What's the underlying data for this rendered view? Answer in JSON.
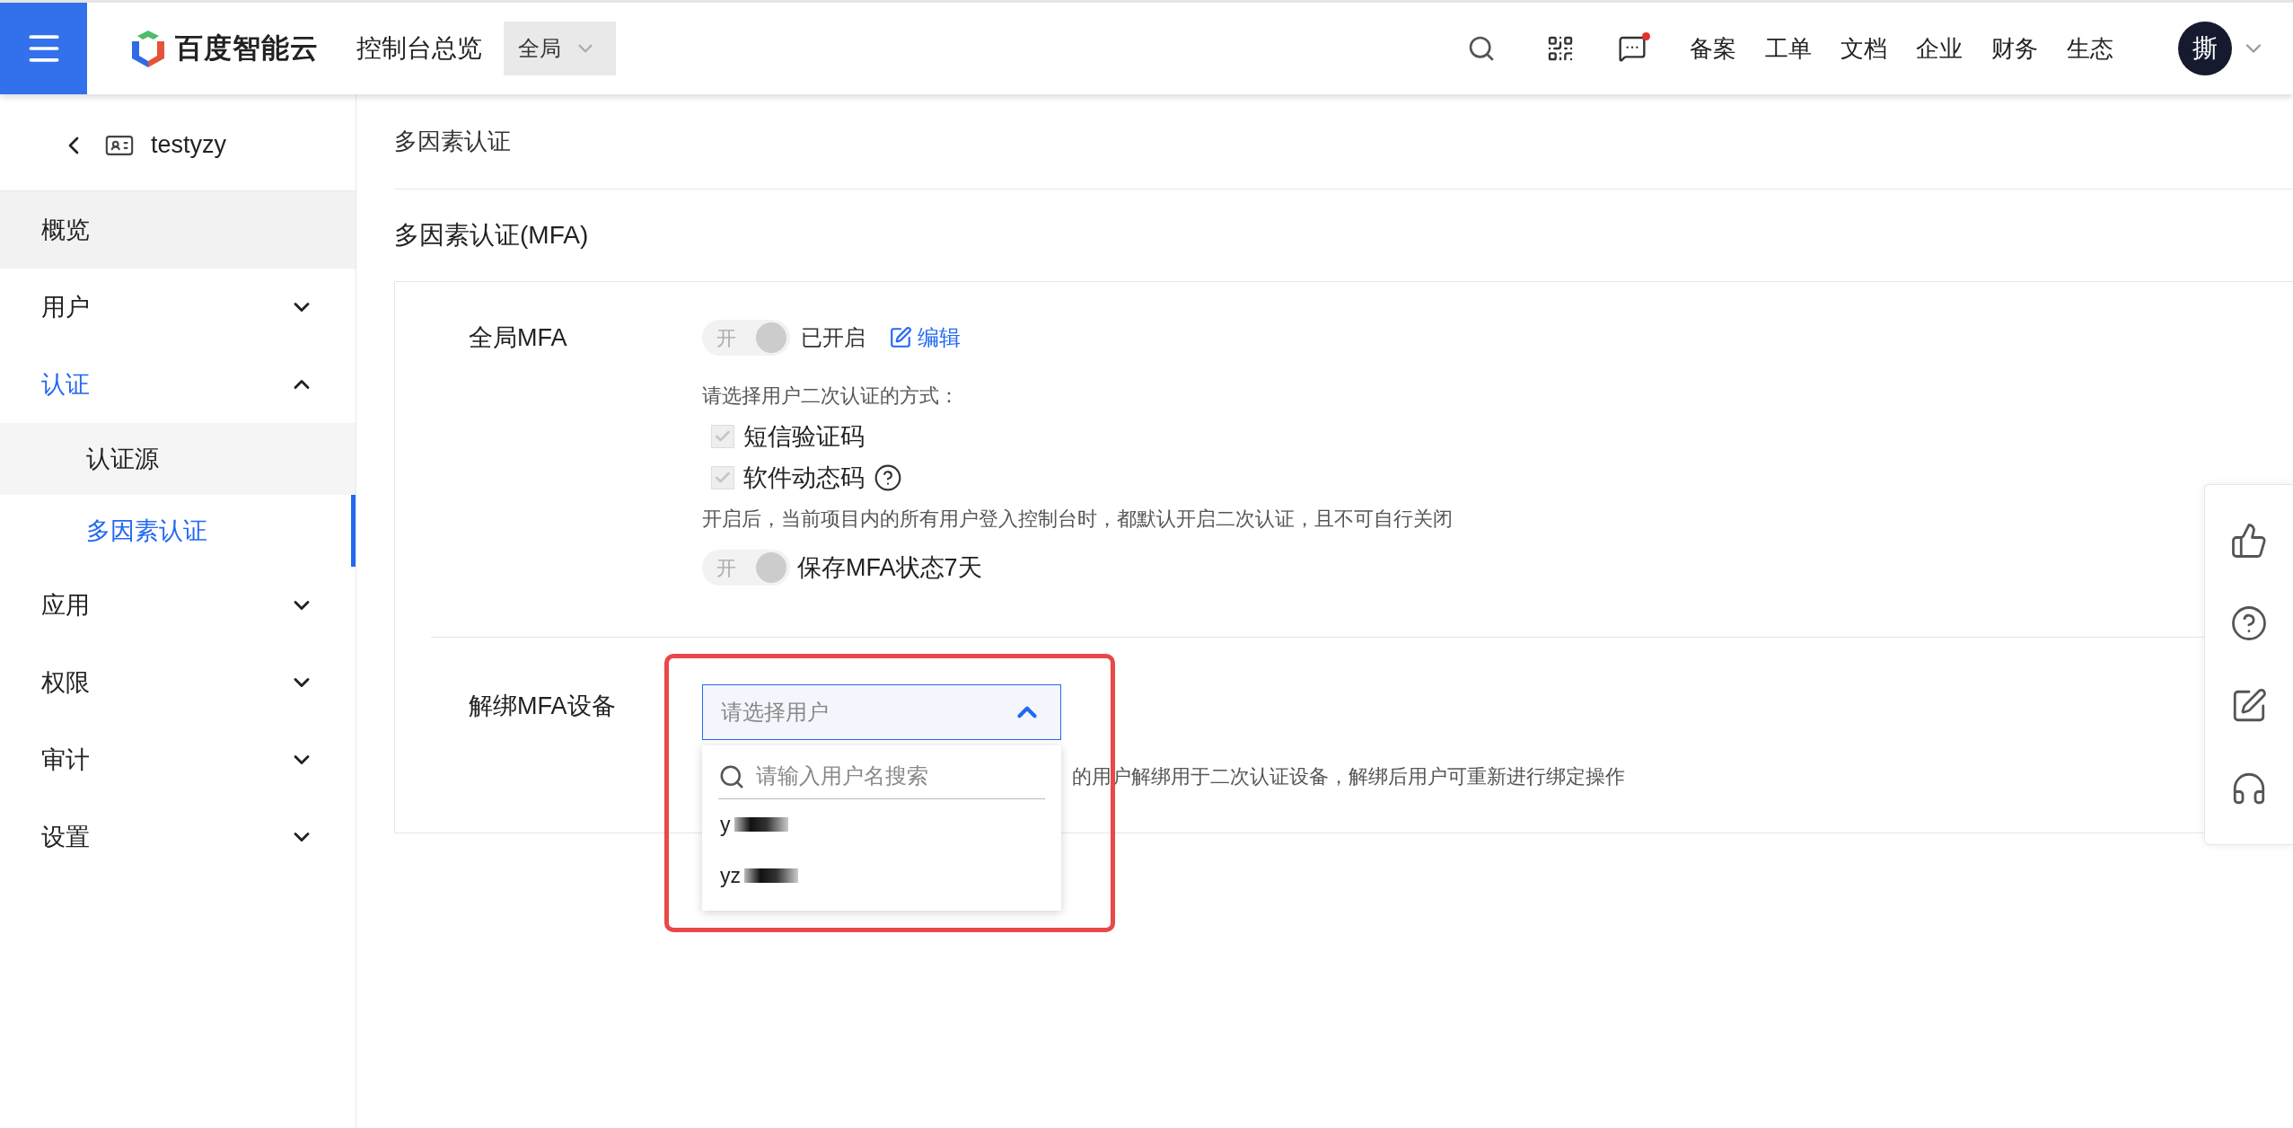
{
  "header": {
    "logo_text": "百度智能云",
    "title": "控制台总览",
    "scope_select": "全局",
    "message_unread": true,
    "nav_links": [
      "备案",
      "工单",
      "文档",
      "企业",
      "财务",
      "生态"
    ],
    "avatar": "撕"
  },
  "sidebar": {
    "project": "testyzy",
    "items": [
      {
        "label": "概览",
        "kind": "link",
        "selected": false
      },
      {
        "label": "用户",
        "kind": "group",
        "expanded": false,
        "selected": false
      },
      {
        "label": "认证",
        "kind": "group",
        "expanded": true,
        "selected": true,
        "children": [
          {
            "label": "认证源",
            "selected": false
          },
          {
            "label": "多因素认证",
            "selected": true
          }
        ]
      },
      {
        "label": "应用",
        "kind": "group",
        "expanded": false,
        "selected": false
      },
      {
        "label": "权限",
        "kind": "group",
        "expanded": false,
        "selected": false
      },
      {
        "label": "审计",
        "kind": "group",
        "expanded": false,
        "selected": false
      },
      {
        "label": "设置",
        "kind": "group",
        "expanded": false,
        "selected": false
      }
    ]
  },
  "breadcrumb": "多因素认证",
  "section_title": "多因素认证(MFA)",
  "global_mfa": {
    "label": "全局MFA",
    "toggle": {
      "label": "开",
      "on": true,
      "disabled": true
    },
    "status": "已开启",
    "edit_link": "编辑",
    "method_hint": "请选择用户二次认证的方式：",
    "methods": [
      {
        "label": "短信验证码",
        "checked": true,
        "disabled": true,
        "help": false
      },
      {
        "label": "软件动态码",
        "checked": true,
        "disabled": true,
        "help": true
      }
    ],
    "note": "开启后，当前项目内的所有用户登入控制台时，都默认开启二次认证，且不可自行关闭",
    "remember": {
      "label": "开",
      "on": true,
      "disabled": true,
      "text": "保存MFA状态7天"
    }
  },
  "unbind": {
    "label": "解绑MFA设备",
    "select": {
      "placeholder": "请选择用户",
      "expanded": true
    },
    "search": {
      "placeholder": "请输入用户名搜索"
    },
    "options": [
      {
        "text": "y"
      },
      {
        "text": "yz"
      }
    ],
    "description": "的用户解绑用于二次认证设备，解绑后用户可重新进行绑定操作"
  }
}
